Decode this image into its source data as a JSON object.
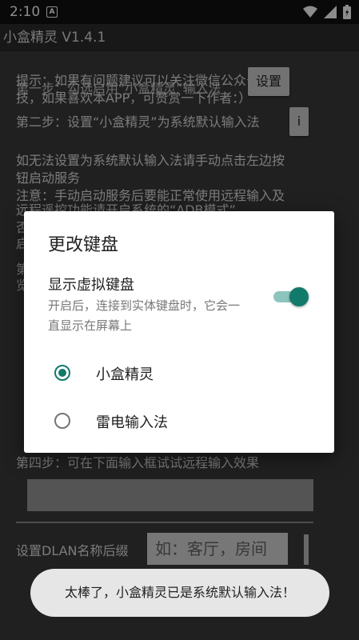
{
  "status_bar": {
    "time": "2:10",
    "notification_icon": "A"
  },
  "app_bar": {
    "title": "小盒精灵  V1.4.1"
  },
  "background": {
    "intro_line1": "提示：如果有问题建议可以关注微信公众号，猫",
    "intro_line2": "技，如果喜欢本APP，可赞赏一下作者：）",
    "step1_overlay": "第一步：勾选启用“小盒精灵”输入法",
    "settings_button": "设置",
    "step2": "第二步：设置“小盒精灵”为系统默认输入法",
    "info_button": "i",
    "note1_line1": "如无法设置为系统默认输入法请手动点击左边按",
    "note1_line2": "钮启动服务",
    "note2_line1": "注意：手动启动服务后要能正常使用远程输入及",
    "note2_line2": "远程遥控功能请开启系统的“ADB模式”",
    "fragment1": "否",
    "fragment2": "启",
    "fragment3": "第",
    "fragment4": "览",
    "step4": "第四步：可在下面输入框试试远程输入效果",
    "dlan_label": "设置DLAN名称后缀",
    "dlan_placeholder": "如：客厅，房间"
  },
  "dialog": {
    "title": "更改键盘",
    "toggle_title": "显示虚拟键盘",
    "toggle_desc": "开启后，连接到实体键盘时，它会一直显示在屏幕上",
    "toggle_on": true,
    "options": [
      {
        "label": "小盒精灵",
        "selected": true
      },
      {
        "label": "雷电输入法",
        "selected": false
      }
    ]
  },
  "toast": {
    "message": "太棒了，小盒精灵已是系统默认输入法！"
  },
  "colors": {
    "accent": "#127a6a",
    "scrim": "#000000"
  }
}
